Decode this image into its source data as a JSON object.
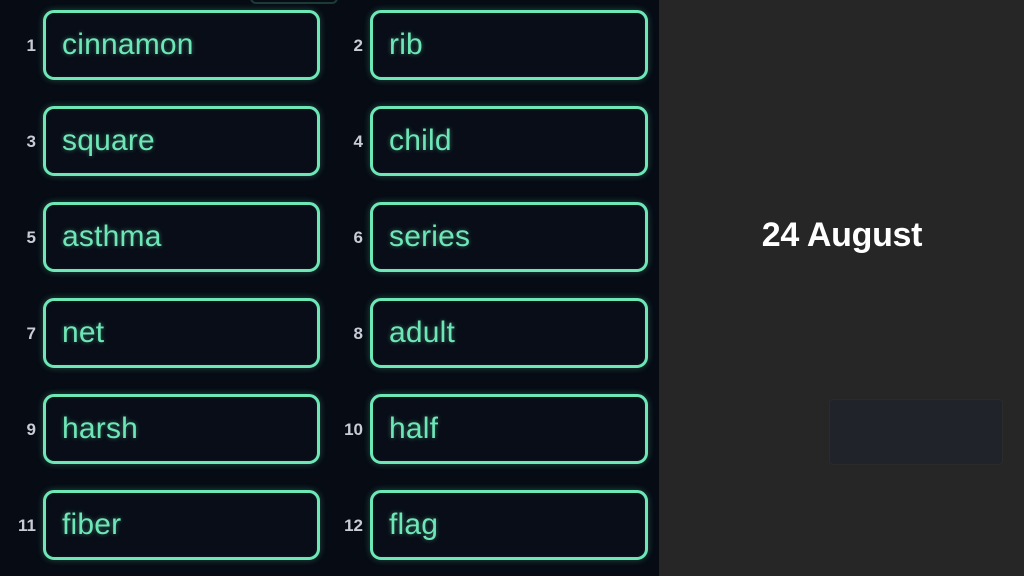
{
  "app": {
    "background_color": "#262626",
    "panel_background_color": "#060b14",
    "accent_color": "#6ee7b7",
    "number_color": "#c9cbd6"
  },
  "right_panel": {
    "date_heading": "24 August",
    "placeholder_card_label": ""
  },
  "quiz": {
    "items": [
      {
        "number": "1",
        "word": "cinnamon"
      },
      {
        "number": "2",
        "word": "rib"
      },
      {
        "number": "3",
        "word": "square"
      },
      {
        "number": "4",
        "word": "child"
      },
      {
        "number": "5",
        "word": "asthma"
      },
      {
        "number": "6",
        "word": "series"
      },
      {
        "number": "7",
        "word": "net"
      },
      {
        "number": "8",
        "word": "adult"
      },
      {
        "number": "9",
        "word": "harsh"
      },
      {
        "number": "10",
        "word": "half"
      },
      {
        "number": "11",
        "word": "fiber"
      },
      {
        "number": "12",
        "word": "flag"
      }
    ]
  }
}
